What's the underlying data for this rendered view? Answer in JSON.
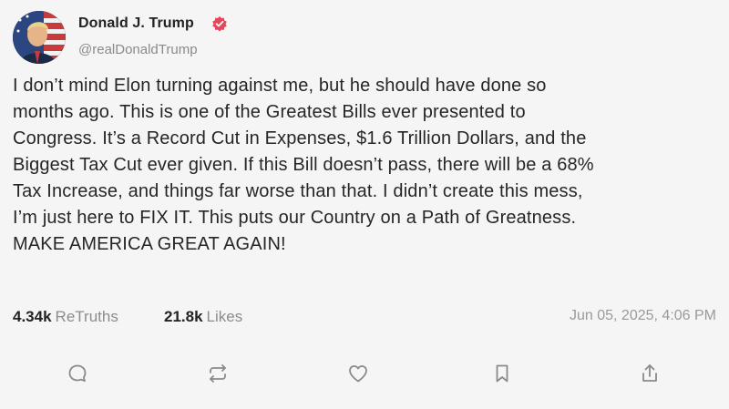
{
  "author": {
    "display_name": "Donald J. Trump",
    "handle": "@realDonaldTrump",
    "verified_icon": "verified-badge-icon",
    "verified_color": "#e8455a"
  },
  "post": {
    "lines": [
      "I don’t mind Elon turning against me, but he should have done so",
      "months ago. This is one of the Greatest Bills ever presented to",
      "Congress. It’s a Record Cut in Expenses, $1.6 Trillion Dollars, and the",
      "Biggest Tax Cut ever given. If this Bill doesn’t pass, there will be a 68%",
      "Tax Increase, and things far worse than that. I didn’t create this mess,",
      "I’m just here to FIX IT. This puts our Country on a Path of Greatness.",
      "MAKE AMERICA GREAT AGAIN!"
    ]
  },
  "stats": {
    "retruths_count": "4.34k",
    "retruths_label": "ReTruths",
    "likes_count": "21.8k",
    "likes_label": "Likes",
    "timestamp": "Jun 05, 2025, 4:06 PM"
  },
  "actions": [
    {
      "icon": "reply-icon"
    },
    {
      "icon": "retruth-icon"
    },
    {
      "icon": "like-heart-icon"
    },
    {
      "icon": "bookmark-icon"
    },
    {
      "icon": "share-icon"
    }
  ]
}
